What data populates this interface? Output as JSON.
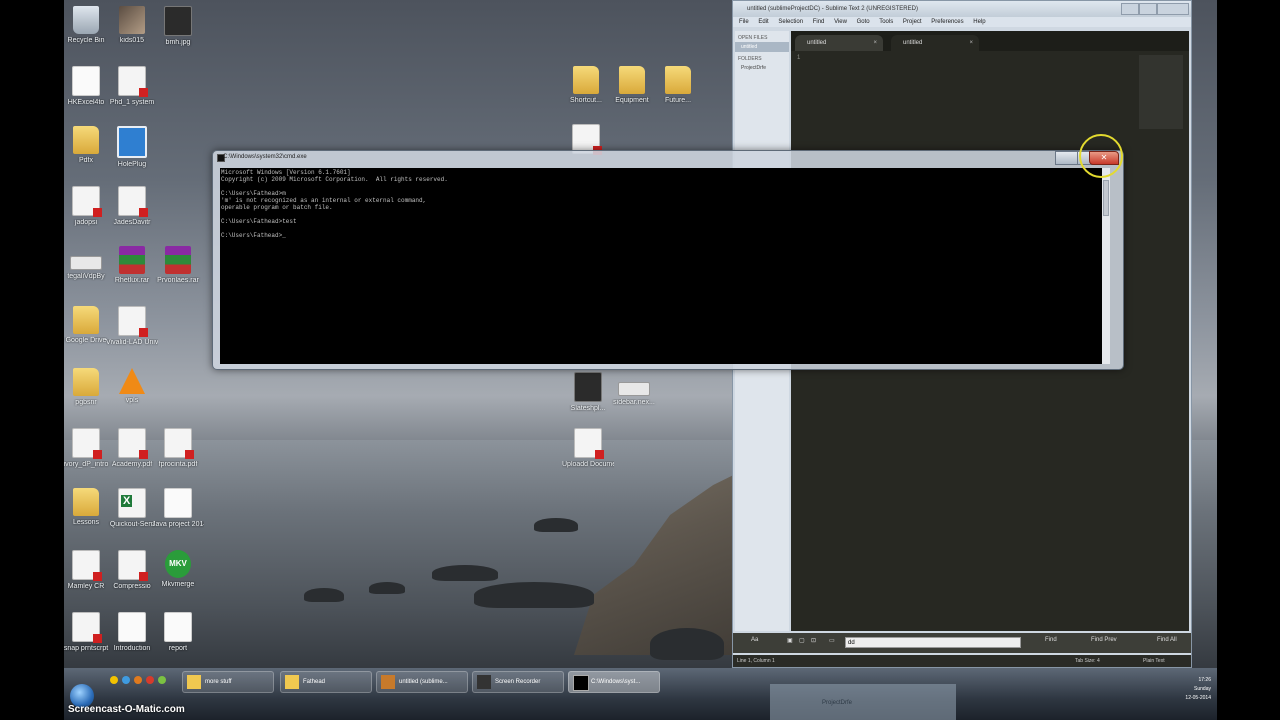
{
  "desktop": {
    "icons": [
      {
        "label": "Recycle Bin"
      },
      {
        "label": "kids015"
      },
      {
        "label": "bmh.jpg"
      },
      {
        "label": "HKExcel4to"
      },
      {
        "label": "Phd_1 system"
      },
      {
        "label": "Pdfx"
      },
      {
        "label": "HolePlug"
      },
      {
        "label": "jadopsi"
      },
      {
        "label": "JadesDavitr"
      },
      {
        "label": "tegaliVdpBy"
      },
      {
        "label": "Rhetlux.rar"
      },
      {
        "label": "Prvonlaes.rar"
      },
      {
        "label": "Google Drive"
      },
      {
        "label": "Vivalid-LAD Universities"
      },
      {
        "label": "pgbsnr"
      },
      {
        "label": "vpls"
      },
      {
        "label": "ivory_dP_intro"
      },
      {
        "label": "Academy.pdf"
      },
      {
        "label": "fprocinta.pdf"
      },
      {
        "label": "Lessons"
      },
      {
        "label": "Quickout-Sem"
      },
      {
        "label": "Java project 2014.docx"
      },
      {
        "label": "Mamley CR"
      },
      {
        "label": "Compressio"
      },
      {
        "label": "Mkvmerge"
      },
      {
        "label": "snap prntscrpt"
      },
      {
        "label": "Introduction"
      },
      {
        "label": "report"
      },
      {
        "label": "Shortcut..."
      },
      {
        "label": "Equipment"
      },
      {
        "label": "Future..."
      },
      {
        "label": ""
      },
      {
        "label": "Slateshpl..."
      },
      {
        "label": "sidebar.nex..."
      },
      {
        "label": "Uploadd Documents"
      }
    ]
  },
  "sublime": {
    "title": "untitled (sublimeProjectDC) - Sublime Text 2 (UNREGISTERED)",
    "menu": [
      "File",
      "Edit",
      "Selection",
      "Find",
      "View",
      "Goto",
      "Tools",
      "Project",
      "Preferences",
      "Help"
    ],
    "sidebar": {
      "open_files_header": "OPEN FILES",
      "open_file": "untitled",
      "folders_header": "FOLDERS",
      "folder": "ProjectDrfe"
    },
    "tabs": [
      "untitled",
      "untitled"
    ],
    "line_number": "1",
    "find_bar": {
      "aa": "Aa",
      "value": "dd",
      "find": "Find",
      "find_prev": "Find Prev",
      "find_all": "Find All"
    },
    "status": {
      "left": "Line 1, Column 1",
      "tab_size": "Tab Size: 4",
      "syntax": "Plain Text"
    }
  },
  "cmd": {
    "title": "C:\\Windows\\system32\\cmd.exe",
    "lines": [
      "Microsoft Windows [Version 6.1.7601]",
      "Copyright (c) 2009 Microsoft Corporation.  All rights reserved.",
      "",
      "C:\\Users\\Fathead>m",
      "'m' is not recognized as an internal or external command,",
      "operable program or batch file.",
      "",
      "C:\\Users\\Fathead>test",
      "",
      "C:\\Users\\Fathead>_"
    ],
    "close_glyph": "✕"
  },
  "taskbar": {
    "buttons": [
      "more stuff",
      "Fathead",
      "untitled (sublime...",
      "Screen Recorder",
      "C:\\Windows\\syst..."
    ],
    "clock_time": "17:26",
    "clock_day": "Sunday",
    "clock_date": "12-05-2014",
    "peek_label": "ProjectDrfe"
  },
  "watermark": "Screencast-O-Matic.com"
}
